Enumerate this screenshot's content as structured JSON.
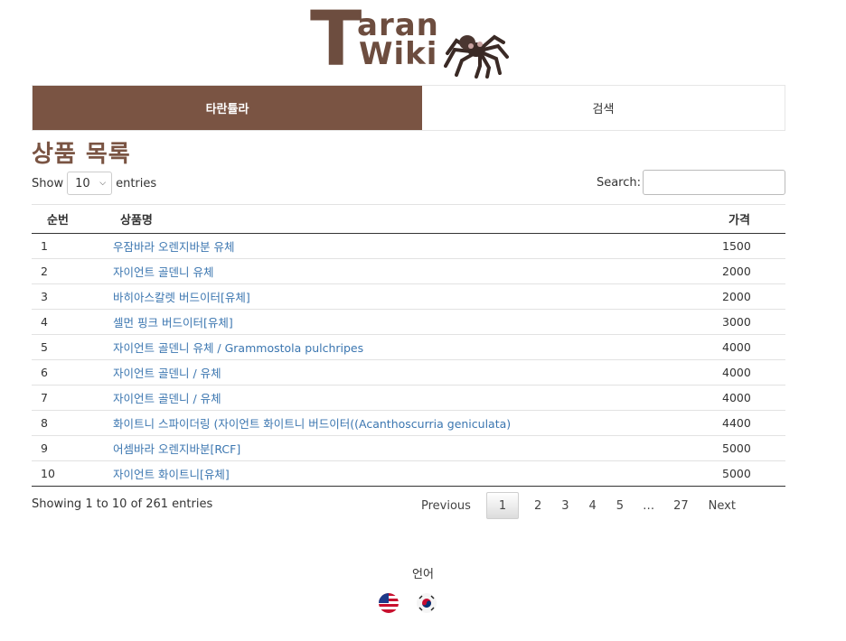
{
  "logo": {
    "letter": "T",
    "line1": "aran",
    "line2": "Wiki"
  },
  "nav": {
    "tabs": [
      {
        "label": "타란튤라"
      },
      {
        "label": "검색"
      }
    ]
  },
  "page_title": "상품 목록",
  "length": {
    "show": "Show",
    "value": "10",
    "entries": "entries"
  },
  "search": {
    "label": "Search:",
    "value": ""
  },
  "table": {
    "headers": [
      "순번",
      "상품명",
      "가격"
    ],
    "rows": [
      {
        "no": "1",
        "name": "우잠바라 오렌지바분 유체",
        "price": "1500"
      },
      {
        "no": "2",
        "name": "자이언트 골덴니 유체",
        "price": "2000"
      },
      {
        "no": "3",
        "name": "바히아스칼렛 버드이터[유체]",
        "price": "2000"
      },
      {
        "no": "4",
        "name": "셀먼 핑크 버드이터[유체]",
        "price": "3000"
      },
      {
        "no": "5",
        "name": "자이언트 골덴니 유체 / Grammostola pulchripes",
        "price": "4000"
      },
      {
        "no": "6",
        "name": "자이언트 골덴니 / 유체",
        "price": "4000"
      },
      {
        "no": "7",
        "name": "자이언트 골덴니 / 유체",
        "price": "4000"
      },
      {
        "no": "8",
        "name": "화이트니 스파이더링 (자이언트 화이트니 버드이터((Acanthoscurria geniculata)",
        "price": "4400"
      },
      {
        "no": "9",
        "name": "어셈바라 오렌지바분[RCF]",
        "price": "5000"
      },
      {
        "no": "10",
        "name": "자이언트 화이트니[유체]",
        "price": "5000"
      }
    ]
  },
  "info": "Showing 1 to 10 of 261 entries",
  "pager": {
    "previous": "Previous",
    "pages": [
      "1",
      "2",
      "3",
      "4",
      "5"
    ],
    "ellipsis": "…",
    "last": "27",
    "next": "Next"
  },
  "footer": {
    "language_label": "언어",
    "flags": [
      "us-flag-icon",
      "kr-flag-icon"
    ]
  },
  "colors": {
    "brand": "#7a5443",
    "link": "#3b76b0"
  }
}
